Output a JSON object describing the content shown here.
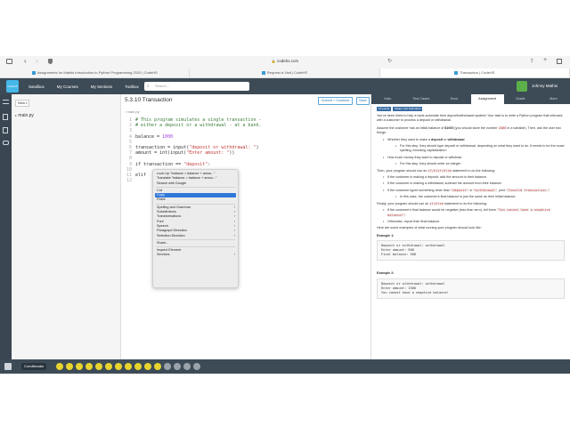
{
  "browser": {
    "address": "codehs.com",
    "tabs": [
      {
        "label": "Assignments for Mathis Introduction to Python Programming 2020 | CodeHS",
        "active": false
      },
      {
        "label": "Request a Visit | CodeHS",
        "active": false
      },
      {
        "label": "Transaction | CodeHS",
        "active": true
      }
    ]
  },
  "app": {
    "logo_text": "CodeHS",
    "nav": [
      "Sandbox",
      "My Courses",
      "My Sections",
      "Toolbox"
    ],
    "search_placeholder": "Search...",
    "user_name": "Johnny Mathis"
  },
  "files": {
    "new_button": "New",
    "file_name": "main.py"
  },
  "editor": {
    "title": "5.3.10 Transaction",
    "submit_label": "Submit + Continue",
    "save_label": "Save",
    "tab": "main.py",
    "lines": [
      {
        "n": "1",
        "seg": [
          {
            "t": "# This program simulates a single transaction -",
            "c": "cm"
          }
        ]
      },
      {
        "n": "2",
        "seg": [
          {
            "t": "# either a deposit or a withdrawal - at a bank.",
            "c": "cm"
          }
        ]
      },
      {
        "n": "3",
        "seg": []
      },
      {
        "n": "4",
        "seg": [
          {
            "t": "balance = ",
            "c": ""
          },
          {
            "t": "1000",
            "c": "nm"
          }
        ]
      },
      {
        "n": "5",
        "seg": []
      },
      {
        "n": "6",
        "seg": [
          {
            "t": "transaction = input(",
            "c": ""
          },
          {
            "t": "\"deposit or withdrawal: \"",
            "c": "st"
          },
          {
            "t": ")",
            "c": ""
          }
        ]
      },
      {
        "n": "7",
        "seg": [
          {
            "t": "amount = int(input(",
            "c": ""
          },
          {
            "t": "\"Enter amount: \"",
            "c": "st"
          },
          {
            "t": "))",
            "c": ""
          }
        ]
      },
      {
        "n": "8",
        "seg": []
      },
      {
        "n": "9",
        "seg": [
          {
            "t": "if transaction == ",
            "c": ""
          },
          {
            "t": "\"deposit\"",
            "c": "st"
          },
          {
            "t": ":",
            "c": ""
          }
        ]
      },
      {
        "n": "10",
        "seg": [
          {
            "t": "    ",
            "c": ""
          }
        ]
      },
      {
        "n": "11",
        "seg": [
          {
            "t": "elif",
            "c": ""
          }
        ]
      },
      {
        "n": "12",
        "seg": []
      }
    ]
  },
  "context_menu": {
    "groups": [
      [
        {
          "label": "Look Up \"balance = balance + amou...\"",
          "sub": false
        },
        {
          "label": "Translate \"balance = balance + amou...\"",
          "sub": false
        },
        {
          "label": "Search with Google",
          "sub": false
        }
      ],
      [
        {
          "label": "Cut",
          "sub": false
        },
        {
          "label": "Copy",
          "sub": false,
          "highlight": true
        },
        {
          "label": "Paste",
          "sub": false
        }
      ],
      [
        {
          "label": "Spelling and Grammar",
          "sub": true
        },
        {
          "label": "Substitutions",
          "sub": true
        },
        {
          "label": "Transformations",
          "sub": true
        },
        {
          "label": "Font",
          "sub": true
        },
        {
          "label": "Speech",
          "sub": true
        },
        {
          "label": "Paragraph Direction",
          "sub": true
        },
        {
          "label": "Selection Direction",
          "sub": true
        }
      ],
      [
        {
          "label": "Share...",
          "sub": false
        }
      ],
      [
        {
          "label": "Inspect Element",
          "sub": false
        },
        {
          "label": "Services",
          "sub": true
        }
      ]
    ]
  },
  "right_panel": {
    "tabs": [
      "Instr.",
      "Test Cases",
      "Docs",
      "Assignment",
      "Grade",
      "More"
    ],
    "active_tab": "Assignment",
    "badge_points": "10 points",
    "badge_status": "Status: Not Submitted",
    "p1": "You've been hired to help a bank automate their deposit/withdrawal system! Your task is to write a Python program that interacts with a customer to process a deposit or withdrawal.",
    "p2a": "Assume the customer has an initial balance of ",
    "p2b": "$1000",
    "p2c": " (you should store the number ",
    "p2d": "1000",
    "p2e": " in a variable). Then, ask the user two things:",
    "b1a": "Whether they want to make a ",
    "b1b": "deposit",
    "b1c": " or ",
    "b1d": "withdrawal",
    "b1sub": "For this step, they should type deposit or withdrawal, depending on what they want to do. It needs to be the exact spelling, including capitalization!",
    "b2": "How much money they want to deposit or withdraw",
    "b2sub": "For this step, they should enter an integer.",
    "p3a": "Then, your program should use an ",
    "p3b": "if/elif/else",
    "p3c": " statement to do the following:",
    "c1": "If the customer is making a deposit, add the amount to their balance.",
    "c2": "If the customer is making a withdrawal, subtract the amount from their balance.",
    "c3a": "If the customer typed something other than ",
    "c3b": "\"deposit\"",
    "c3c": " or ",
    "c3d": "\"withdrawal\"",
    "c3e": ", print ",
    "c3f": "\"Invalid transaction.\"",
    "c3g": ".",
    "c3sub": "In this case, the customer's final balance is just the same as their initial balance.",
    "p4a": "Finally, your program should use an ",
    "p4b": "if/else",
    "p4c": " statement to do the following:",
    "d1a": "If the customer's final balance would be negative (less than zero), tell them ",
    "d1b": "\"You cannot have a negative balance!\"",
    "d1c": ".",
    "d2": "Otherwise, report their final balance.",
    "p5": "Here are some examples of what running your program should look like:",
    "ex1_title": "Example 1:",
    "ex1": [
      "Deposit or withdrawal: withdrawal",
      "Enter amount: 500",
      "Final balance: 500"
    ],
    "ex2_title": "Example 2:",
    "ex2": [
      "Deposit or withdrawal: withdrawal",
      "Enter amount: 1500",
      "You cannot have a negative balance!"
    ]
  },
  "bottom": {
    "label": "Conditionals"
  }
}
